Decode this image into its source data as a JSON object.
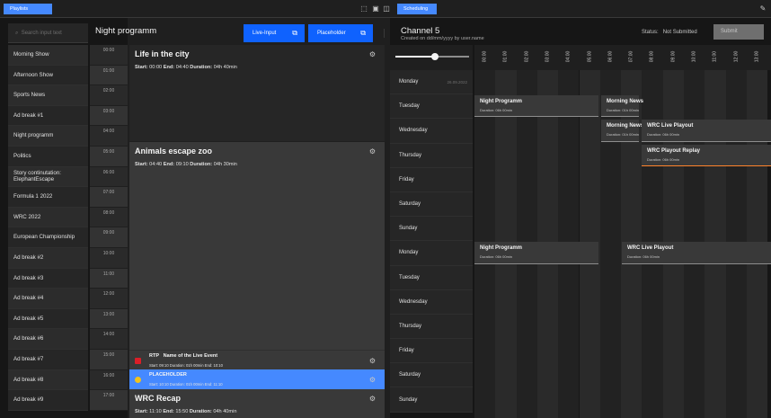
{
  "left_tab": {
    "label": "Playlists"
  },
  "right_tab": {
    "label": "Scheduling"
  },
  "search": {
    "placeholder": "Search input text"
  },
  "playlist_items": [
    "Morning Show",
    "Afternoon Show",
    "Sports News",
    "Ad break #1",
    "Night programm",
    "Politics",
    "Story continutation: ElephantEscape",
    "Formula 1 2022",
    "WRC 2022",
    "European Championship",
    "Ad break #2",
    "Ad break #3",
    "Ad break #4",
    "Ad break #5",
    "Ad break #6",
    "Ad break #7",
    "Ad break #8",
    "Ad break #9"
  ],
  "timeline_times": [
    "00:00",
    "01:00",
    "02:00",
    "03:00",
    "04:00",
    "05:00",
    "06:00",
    "07:00",
    "08:00",
    "09:00",
    "10:00",
    "11:00",
    "12:00",
    "13:00",
    "14:00",
    "15:00",
    "16:00",
    "17:00"
  ],
  "middle": {
    "title": "Night programm",
    "live_input_label": "Live-Input",
    "placeholder_label": "Placeholder",
    "programs": [
      {
        "title": "Life in the city",
        "start_label": "Start:",
        "start": "00:00",
        "end_label": "End:",
        "end": "04:40",
        "duration_label": "Duration:",
        "duration": "04h 40min"
      },
      {
        "title": "Animals escape zoo",
        "start_label": "Start:",
        "start": "04:40",
        "end_label": "End:",
        "end": "09:10",
        "duration_label": "Duration:",
        "duration": "04h 30min"
      },
      {
        "title": "WRC Recap",
        "start_label": "Start:",
        "start": "11:10",
        "end_label": "End:",
        "end": "15:50",
        "duration_label": "Duration:",
        "duration": "04h 40min"
      }
    ],
    "live_event": {
      "tag": "RTP",
      "title": "Name of the Live Event",
      "sub": "Start: 09:10    Duration: 01h 00min    End: 10:10"
    },
    "placeholder_event": {
      "title": "PLACEHOLDER",
      "sub": "Start: 10:10    Duration: 01h 00min    End: 11:10"
    }
  },
  "right": {
    "channel": "Channel 5",
    "created": "Created on dd/mm/yyyy by user.name",
    "status_label": "Status:",
    "status_value": "Not Submitted",
    "submit_label": "Submit",
    "hours": [
      "00:00",
      "01:00",
      "02:00",
      "03:00",
      "04:00",
      "05:00",
      "06:00",
      "07:00",
      "08:00",
      "09:00",
      "10:00",
      "11:00",
      "12:00",
      "13:00"
    ],
    "days": [
      {
        "name": "Monday",
        "date": "26.09.2022"
      },
      {
        "name": "Tuesday",
        "date": ""
      },
      {
        "name": "Wednesday",
        "date": ""
      },
      {
        "name": "Thursday",
        "date": ""
      },
      {
        "name": "Friday",
        "date": ""
      },
      {
        "name": "Saturday",
        "date": ""
      },
      {
        "name": "Sunday",
        "date": ""
      },
      {
        "name": "Monday",
        "date": ""
      },
      {
        "name": "Tuesday",
        "date": ""
      },
      {
        "name": "Wednesday",
        "date": ""
      },
      {
        "name": "Thursday",
        "date": ""
      },
      {
        "name": "Friday",
        "date": ""
      },
      {
        "name": "Saturday",
        "date": ""
      },
      {
        "name": "Sunday",
        "date": ""
      }
    ],
    "schedule": [
      {
        "title": "Night Programm",
        "duration": "Duration: 06h 00min",
        "day": 1
      },
      {
        "title": "Morning News",
        "duration": "Duration: 01h 00min",
        "day": 1
      },
      {
        "title": "Morning News",
        "duration": "Duration: 01h 00min",
        "day": 2
      },
      {
        "title": "WRC Live Playout",
        "duration": "Duration: 06h 00min",
        "day": 2
      },
      {
        "title": "WRC Playout Replay",
        "duration": "Duration: 06h 00min",
        "day": 3
      },
      {
        "title": "Night Programm",
        "duration": "Duration: 06h 00min",
        "day": 7
      },
      {
        "title": "WRC Live Playout",
        "duration": "Duration: 06h 00min",
        "day": 7
      }
    ]
  },
  "colors": {
    "accent": "#0f62fe",
    "tab": "#4589ff",
    "live_dot": "#da1e28",
    "placeholder_dot": "#f1c21b",
    "placeholder_bg": "#4589ff"
  }
}
